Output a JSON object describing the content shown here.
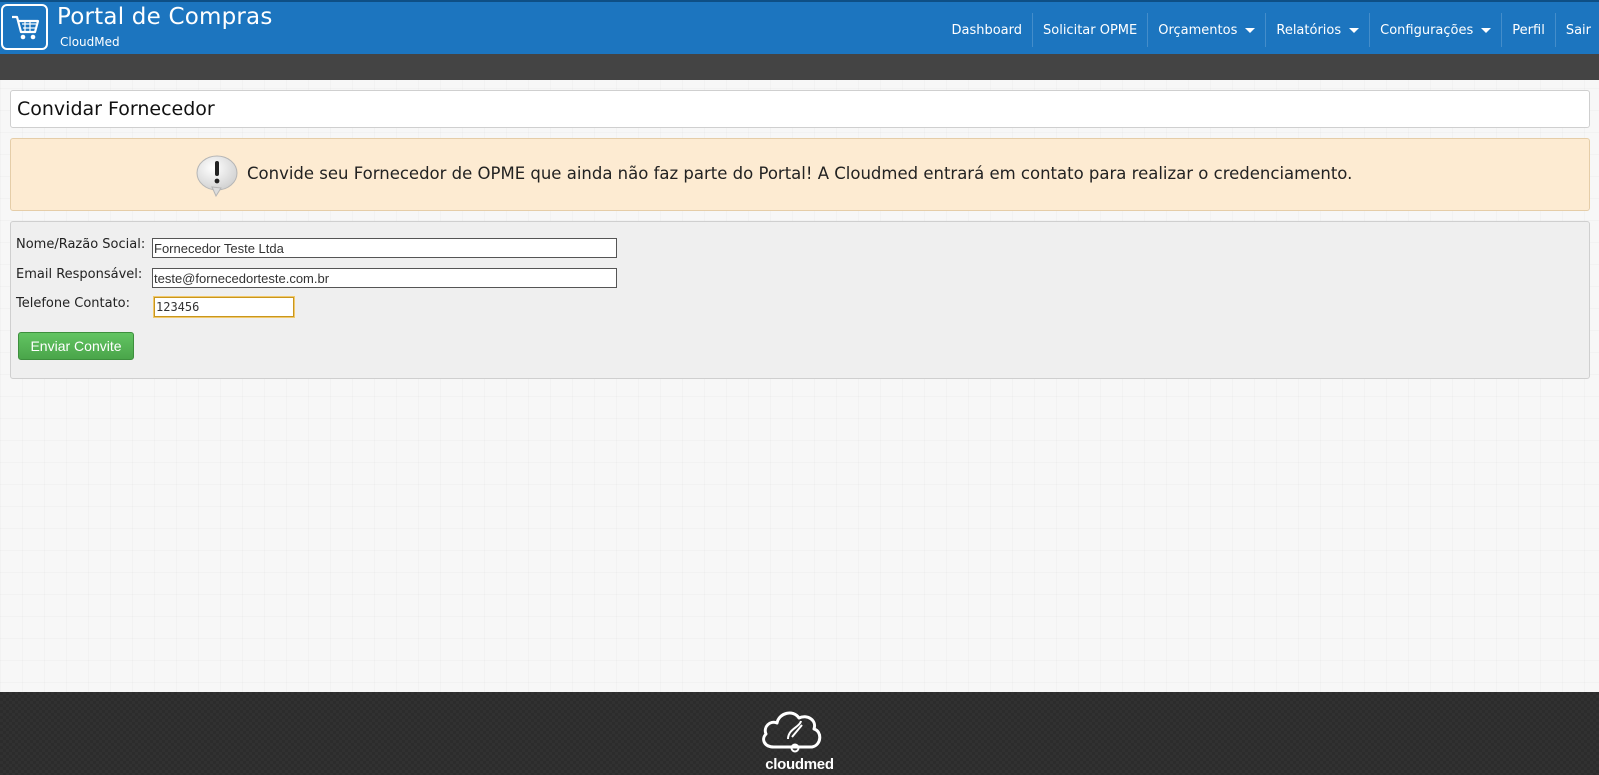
{
  "header": {
    "title": "Portal de Compras",
    "subtitle": "CloudMed",
    "nav": [
      {
        "label": "Dashboard"
      },
      {
        "label": "Solicitar OPME"
      },
      {
        "label": "Orçamentos"
      },
      {
        "label": "Relatórios"
      },
      {
        "label": "Configurações"
      },
      {
        "label": "Perfil"
      },
      {
        "label": "Sair"
      }
    ]
  },
  "page": {
    "title": "Convidar Fornecedor"
  },
  "alert": {
    "text": "Convide seu Fornecedor de OPME que ainda não faz parte do Portal! A Cloudmed entrará em contato para realizar o credenciamento."
  },
  "form": {
    "name_label": "Nome/Razão Social:",
    "name_value": "Fornecedor Teste Ltda",
    "email_label": "Email Responsável:",
    "email_value": "teste@fornecedorteste.com.br",
    "phone_label": "Telefone Contato:",
    "phone_value": "123456",
    "submit_label": "Enviar Convite"
  },
  "footer": {
    "brand": "cloudmed"
  },
  "colors": {
    "header_bg": "#1c75bf",
    "subbar_bg": "#444444",
    "alert_bg": "#fdebd2",
    "button_green": "#5cb85c",
    "footer_bg": "#2c2c2c"
  }
}
